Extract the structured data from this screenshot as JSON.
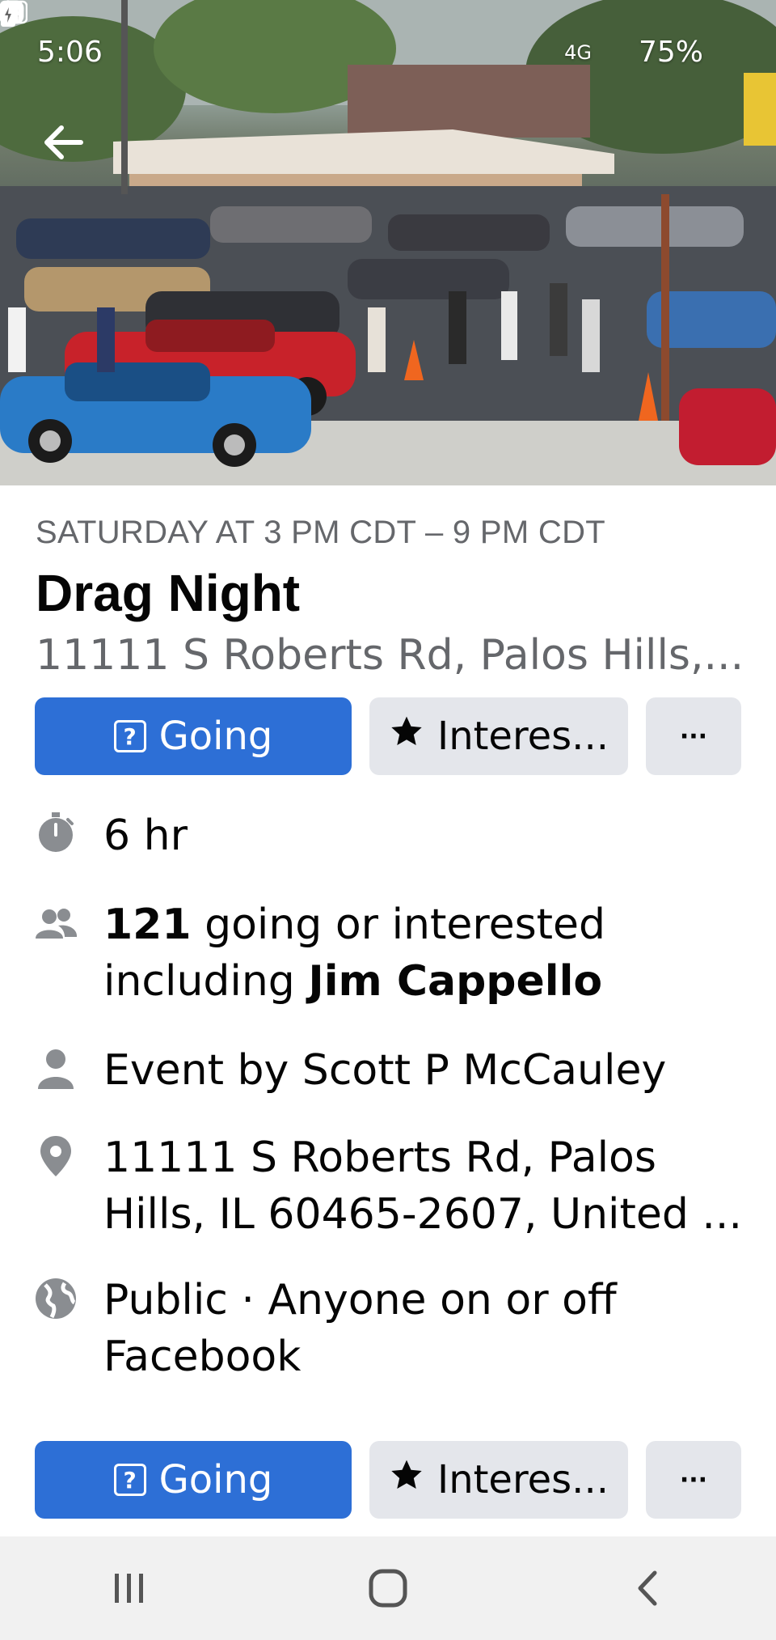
{
  "status_bar": {
    "time": "5:06",
    "notification_icons": [
      "facebook-icon",
      "ring-icon",
      "instagram-icon"
    ],
    "system_icons": [
      "recycle-icon",
      "bluetooth-icon",
      "4g-signal-icon"
    ],
    "network": "4G",
    "battery": "75%"
  },
  "event": {
    "date_time": "SATURDAY AT 3 PM CDT – 9 PM CDT",
    "title": "Drag Night",
    "short_address": "11111 S Roberts Rd, Palos Hills,..."
  },
  "actions": {
    "going_label": "Going",
    "interested_label": "Interes...",
    "more_label": "···"
  },
  "details": {
    "duration": "6 hr",
    "attendance_count": "121",
    "attendance_text": " going or interested",
    "including_text": "including ",
    "including_name": "Jim Cappello",
    "host_text": "Event by Scott P McCauley",
    "location_line1": "11111 S Roberts Rd, Palos",
    "location_line2": "Hills, IL 60465-2607, United ...",
    "privacy_line1": "Public · Anyone on or off",
    "privacy_line2": "Facebook"
  },
  "colors": {
    "primary": "#2d6fd6",
    "secondary_bg": "#e4e6eb",
    "muted_text": "#65676b",
    "icon_gray": "#8a8d91"
  },
  "icons": {
    "back": "back-arrow-icon",
    "duration": "stopwatch-icon",
    "attendance": "people-icon",
    "host": "person-icon",
    "location": "location-pin-icon",
    "privacy": "globe-icon",
    "interested": "star-icon",
    "going": "question-badge-icon"
  },
  "system_nav": {
    "buttons": [
      "recents-icon",
      "home-icon",
      "back-nav-icon"
    ]
  }
}
